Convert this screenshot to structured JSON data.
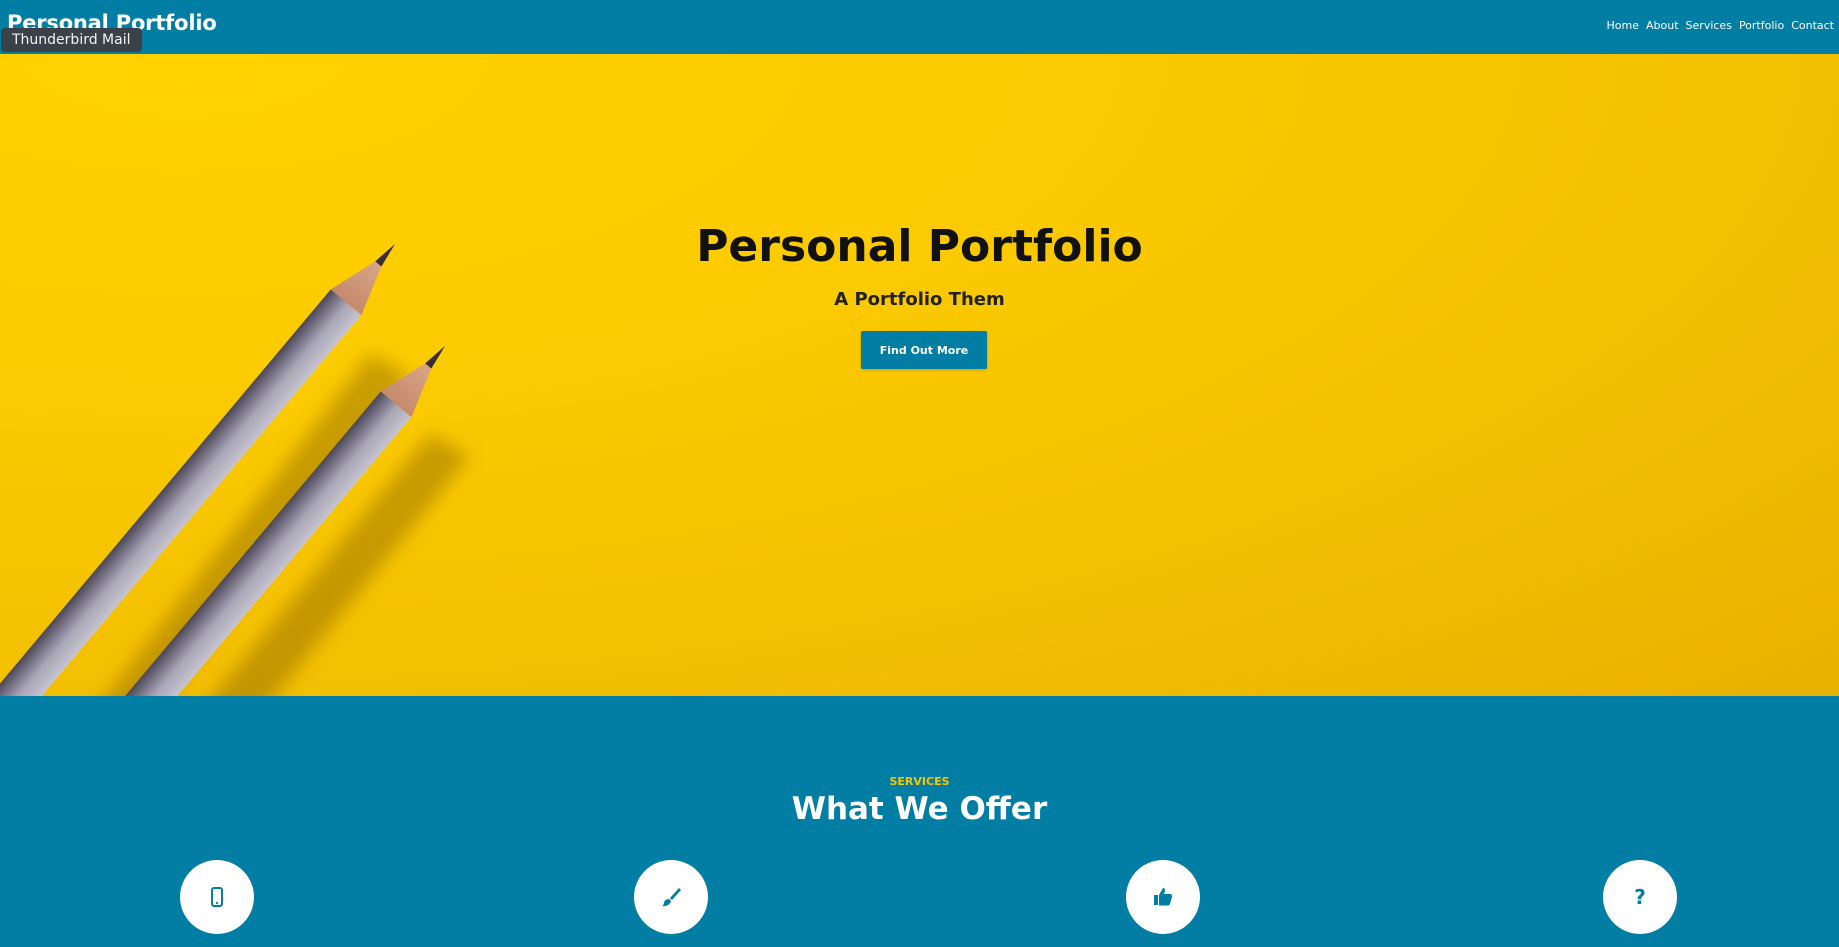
{
  "navbar": {
    "brand": "Personal Portfolio",
    "links": [
      "Home",
      "About",
      "Services",
      "Portfolio",
      "Contact"
    ]
  },
  "tooltip": "Thunderbird Mail",
  "hero": {
    "title": "Personal Portfolio",
    "subtitle": "A Portfolio Them",
    "button": "Find Out More"
  },
  "services": {
    "eyebrow": "SERVICES",
    "title": "What We Offer",
    "icons": [
      "mobile-phone-icon",
      "paint-brush-icon",
      "thumbs-up-icon",
      "question-mark-icon"
    ]
  },
  "colors": {
    "primary": "#027da3",
    "accent": "#f7c600",
    "hero_background": "#fccb00",
    "text_dark": "#111111"
  }
}
